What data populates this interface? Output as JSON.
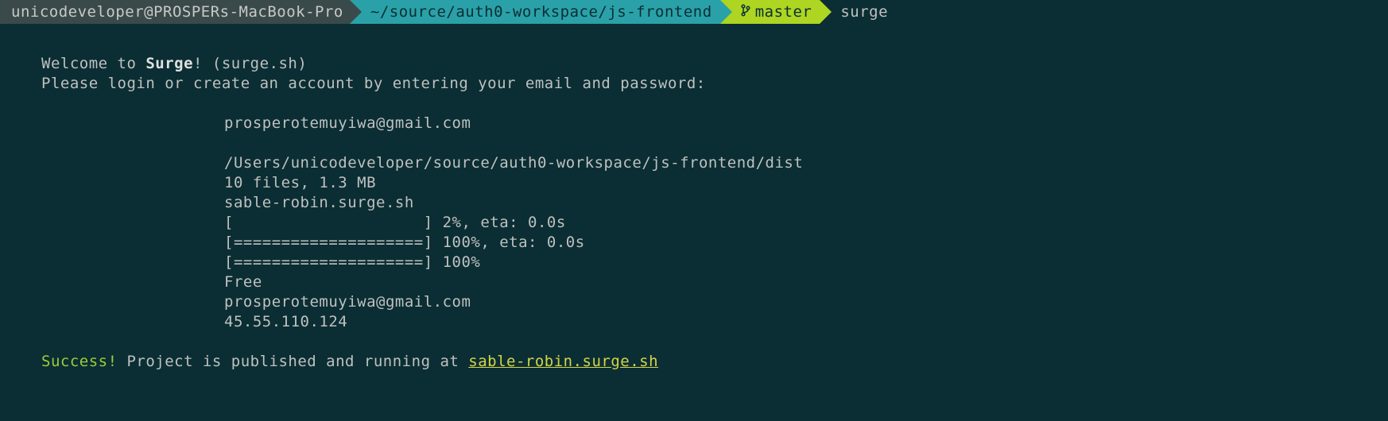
{
  "prompt": {
    "host": "unicodeveloper@PROSPERs-MacBook-Pro",
    "path": "~/source/auth0-workspace/js-frontend",
    "branch": "master",
    "command": "surge"
  },
  "welcome": {
    "prefix": "Welcome to ",
    "app": "Surge",
    "suffix": "! (surge.sh)"
  },
  "login_prompt": "Please login or create an account by entering your email and password:",
  "details": {
    "email": "prosperotemuyiwa@gmail.com",
    "path": "/Users/unicodeveloper/source/auth0-workspace/js-frontend/dist",
    "file_summary": "10 files, 1.3 MB",
    "domain": "sable-robin.surge.sh",
    "progress1": "[                    ] 2%, eta: 0.0s",
    "progress2": "[====================] 100%, eta: 0.0s",
    "progress3": "[====================] 100%",
    "plan": "Free",
    "email2": "prosperotemuyiwa@gmail.com",
    "ip": "45.55.110.124"
  },
  "success": {
    "label": "Success!",
    "message": " Project is published and running at ",
    "url": "sable-robin.surge.sh"
  }
}
